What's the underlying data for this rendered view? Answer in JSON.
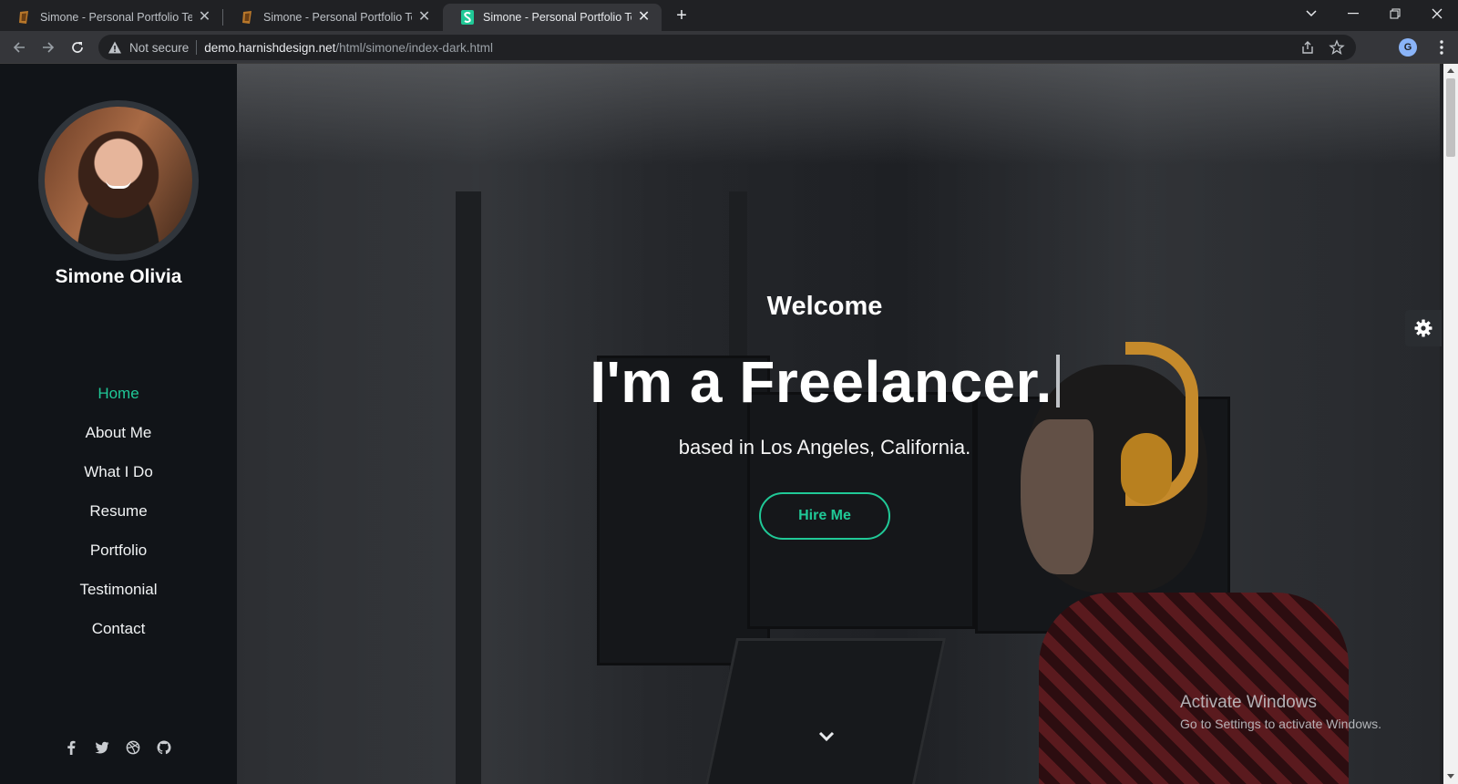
{
  "browser": {
    "tabs": [
      {
        "title": "Simone - Personal Portfolio Temp",
        "favicon": "simone-orange-favicon"
      },
      {
        "title": "Simone - Personal Portfolio Temp",
        "favicon": "simone-orange-favicon"
      },
      {
        "title": "Simone - Personal Portfolio Temp",
        "favicon": "simone-green-s-favicon"
      }
    ],
    "active_tab_index": 2,
    "close_glyph": "✕",
    "new_tab_glyph": "+",
    "address": {
      "security_label": "Not secure",
      "host": "demo.harnishdesign.net",
      "path": "/html/simone/index-dark.html"
    },
    "profile_initial": "G"
  },
  "sidebar": {
    "name": "Simone Olivia",
    "nav": [
      {
        "label": "Home",
        "active": true
      },
      {
        "label": "About Me",
        "active": false
      },
      {
        "label": "What I Do",
        "active": false
      },
      {
        "label": "Resume",
        "active": false
      },
      {
        "label": "Portfolio",
        "active": false
      },
      {
        "label": "Testimonial",
        "active": false
      },
      {
        "label": "Contact",
        "active": false
      }
    ],
    "social_icons": [
      "facebook-icon",
      "twitter-icon",
      "dribbble-icon",
      "github-icon"
    ]
  },
  "hero": {
    "welcome": "Welcome",
    "headline": "I'm a Freelancer.",
    "subline": "based in Los Angeles, California.",
    "cta": "Hire Me"
  },
  "overlay": {
    "activate_title": "Activate Windows",
    "activate_sub": "Go to Settings to activate Windows."
  },
  "colors": {
    "accent": "#20c997",
    "sidebar_bg": "#111418",
    "chrome_bg": "#202124",
    "toolbar_bg": "#35363a"
  }
}
